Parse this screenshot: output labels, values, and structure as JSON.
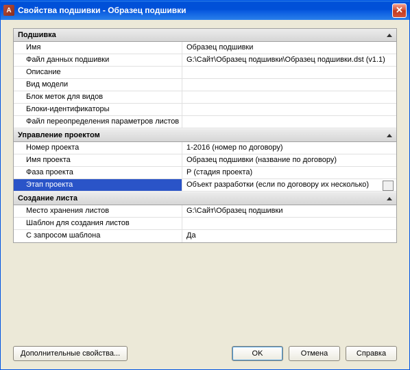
{
  "window": {
    "title": "Свойства подшивки - Образец подшивки",
    "iconLetter": "A"
  },
  "groups": {
    "podshivka": {
      "title": "Подшивка"
    },
    "project": {
      "title": "Управление проектом"
    },
    "sheet": {
      "title": "Создание листа"
    }
  },
  "podshivka": {
    "name": {
      "label": "Имя",
      "value": "Образец подшивки"
    },
    "dataFile": {
      "label": "Файл данных подшивки",
      "value": "G:\\Сайт\\Образец подшивки\\Образец подшивки.dst (v1.1)"
    },
    "description": {
      "label": "Описание",
      "value": ""
    },
    "modelView": {
      "label": "Вид модели",
      "value": ""
    },
    "labelBlock": {
      "label": "Блок меток для видов",
      "value": ""
    },
    "idBlocks": {
      "label": "Блоки-идентификаторы",
      "value": ""
    },
    "override": {
      "label": "Файл переопределения параметров листов",
      "value": ""
    }
  },
  "project": {
    "number": {
      "label": "Номер проекта",
      "value": "1-2016 (номер по договору)"
    },
    "name": {
      "label": "Имя проекта",
      "value": "Образец подшивки (название по договору)"
    },
    "phase": {
      "label": "Фаза проекта",
      "value": "Р (стадия проекта)"
    },
    "stage": {
      "label": "Этап проекта",
      "value": "Объект разработки (если по договору их несколько)"
    }
  },
  "sheet": {
    "storage": {
      "label": "Место хранения листов",
      "value": "G:\\Сайт\\Образец подшивки"
    },
    "template": {
      "label": "Шаблон для создания листов",
      "value": ""
    },
    "prompt": {
      "label": "С запросом шаблона",
      "value": "Да"
    }
  },
  "buttons": {
    "extra": "Дополнительные свойства...",
    "ok": "OK",
    "cancel": "Отмена",
    "help": "Справка"
  }
}
